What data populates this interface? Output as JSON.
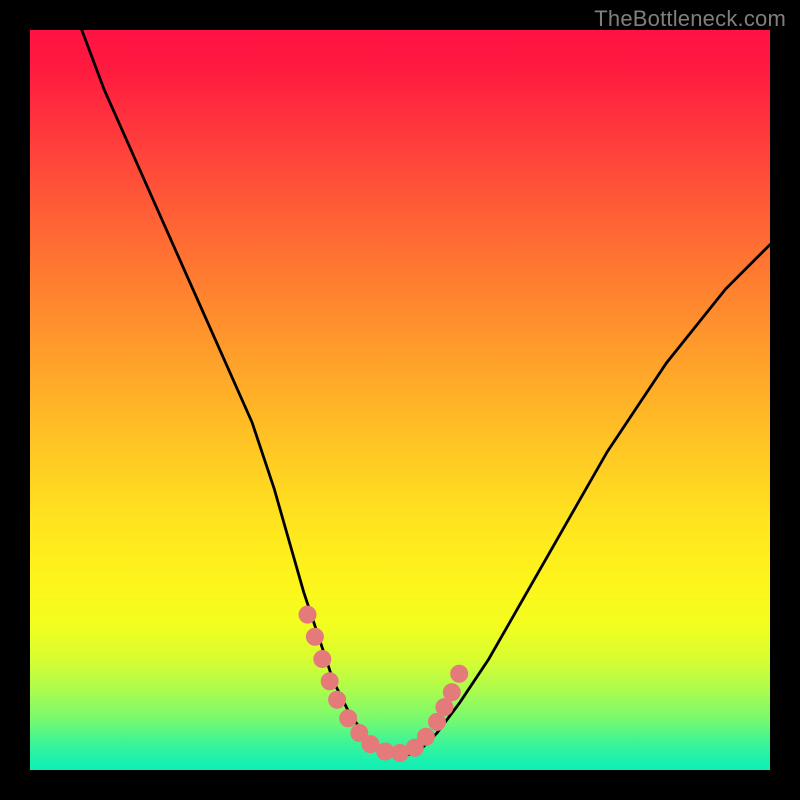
{
  "watermark": "TheBottleneck.com",
  "colors": {
    "frame": "#000000",
    "curve_stroke": "#000000",
    "marker_fill": "#e47a7a",
    "marker_stroke": "#e47a7a"
  },
  "chart_data": {
    "type": "line",
    "title": "",
    "xlabel": "",
    "ylabel": "",
    "xlim": [
      0,
      100
    ],
    "ylim": [
      0,
      100
    ],
    "grid": false,
    "legend": null,
    "series": [
      {
        "name": "bottleneck-curve",
        "x": [
          7,
          10,
          14,
          18,
          22,
          26,
          30,
          33,
          35,
          37,
          39,
          41,
          43,
          45,
          47,
          49,
          51,
          53,
          55,
          58,
          62,
          66,
          70,
          74,
          78,
          82,
          86,
          90,
          94,
          98,
          100
        ],
        "y": [
          100,
          92,
          83,
          74,
          65,
          56,
          47,
          38,
          31,
          24,
          18,
          12,
          8,
          5,
          3,
          2,
          2,
          3,
          5,
          9,
          15,
          22,
          29,
          36,
          43,
          49,
          55,
          60,
          65,
          69,
          71
        ]
      }
    ],
    "markers": {
      "name": "highlight-points",
      "x": [
        37.5,
        38.5,
        39.5,
        40.5,
        41.5,
        43,
        44.5,
        46,
        48,
        50,
        52,
        53.5,
        55,
        56,
        57,
        58
      ],
      "y": [
        21,
        18,
        15,
        12,
        9.5,
        7,
        5,
        3.5,
        2.5,
        2.3,
        3,
        4.5,
        6.5,
        8.5,
        10.5,
        13
      ]
    }
  }
}
